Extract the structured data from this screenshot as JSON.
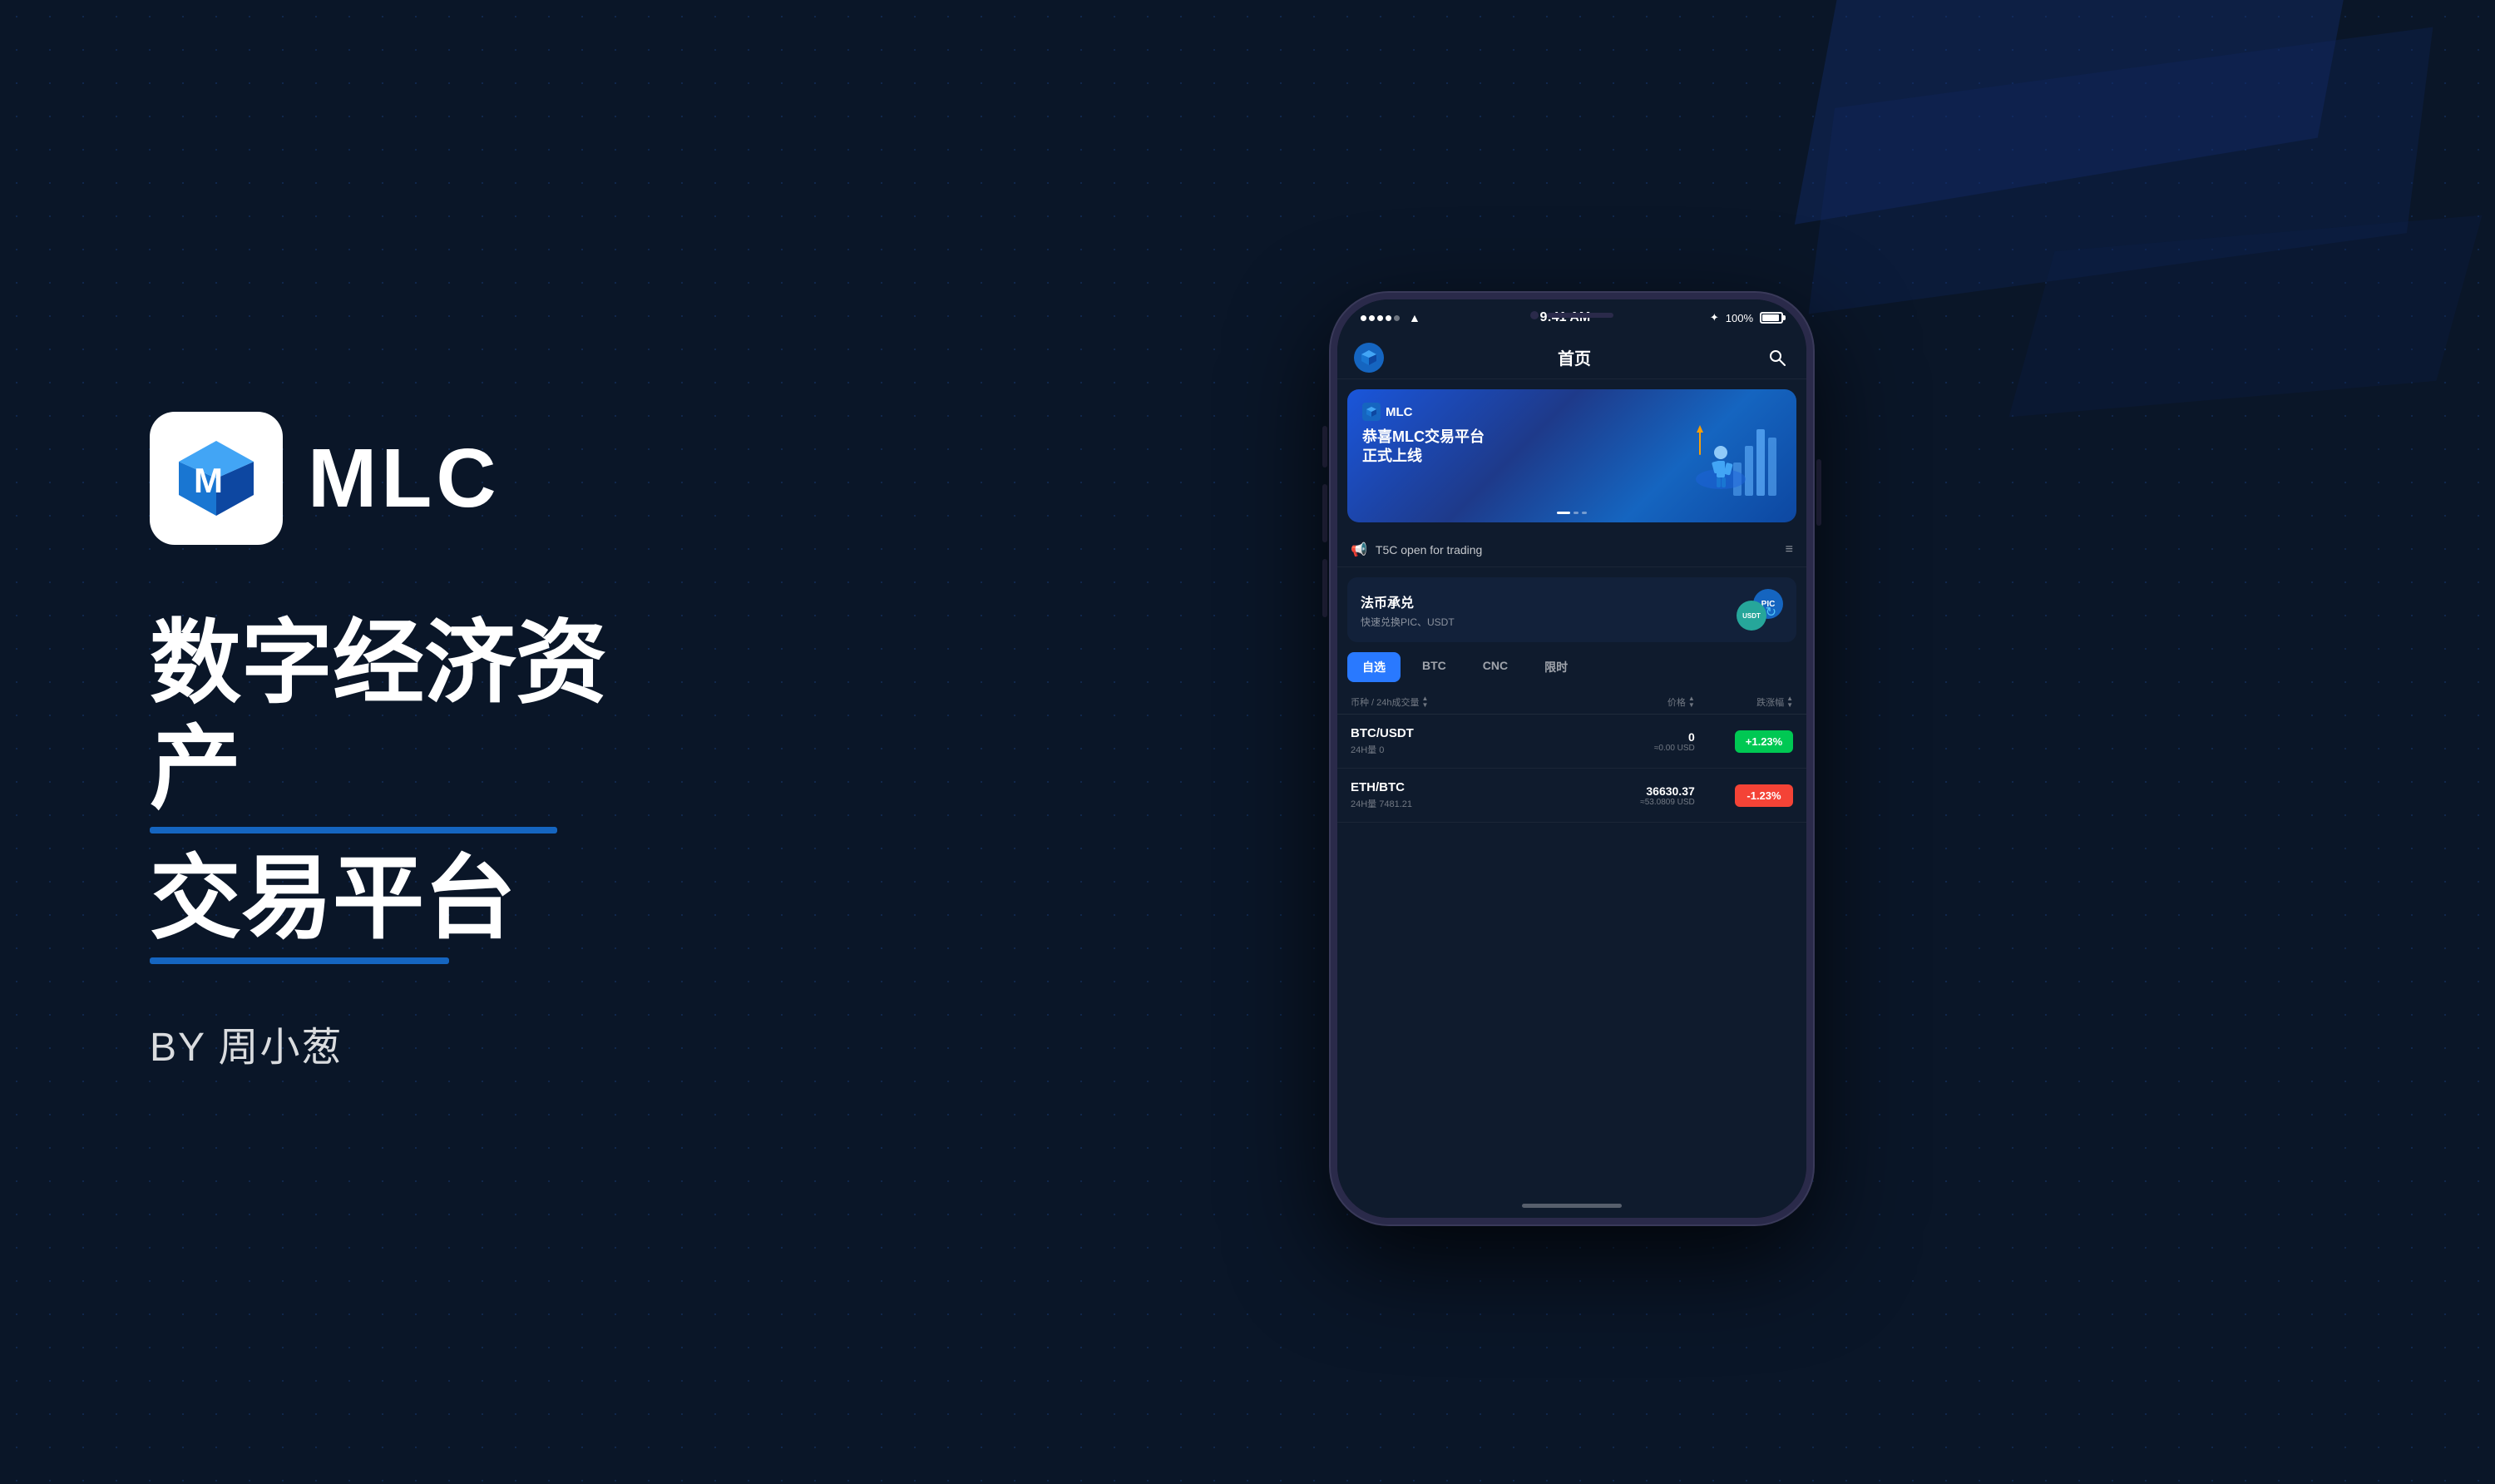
{
  "background": {
    "color": "#0a1628"
  },
  "left_panel": {
    "logo_text": "MLC",
    "title_line1": "数字经济资产",
    "title_line2": "交易平台",
    "by_line": "BY 周小葱"
  },
  "phone": {
    "status_bar": {
      "time": "9:41 AM",
      "battery": "100%"
    },
    "header": {
      "title": "首页"
    },
    "banner": {
      "badge_text": "MLC",
      "title_line1": "恭喜MLC交易平台",
      "title_line2": "正式上线"
    },
    "ticker": {
      "text": "T5C open for trading"
    },
    "fabi_section": {
      "title": "法币承兑",
      "subtitle": "快速兑换PIC、USDT"
    },
    "tabs": [
      {
        "label": "自选",
        "active": true
      },
      {
        "label": "BTC",
        "active": false
      },
      {
        "label": "CNC",
        "active": false
      },
      {
        "label": "限时",
        "active": false
      }
    ],
    "table_headers": [
      {
        "label": "币种 / 24h成交量"
      },
      {
        "label": "价格"
      },
      {
        "label": "跌涨幅"
      }
    ],
    "rows": [
      {
        "pair": "BTC/USDT",
        "volume_label": "24H量",
        "volume": "0",
        "price": "0",
        "price_usd": "≈0.00 USD",
        "change": "+1.23%",
        "positive": true
      },
      {
        "pair": "ETH/BTC",
        "volume_label": "24H量",
        "volume": "7481.21",
        "price": "36630.37",
        "price_usd": "≈53.0809 USD",
        "change": "-1.23%",
        "positive": false
      }
    ]
  }
}
